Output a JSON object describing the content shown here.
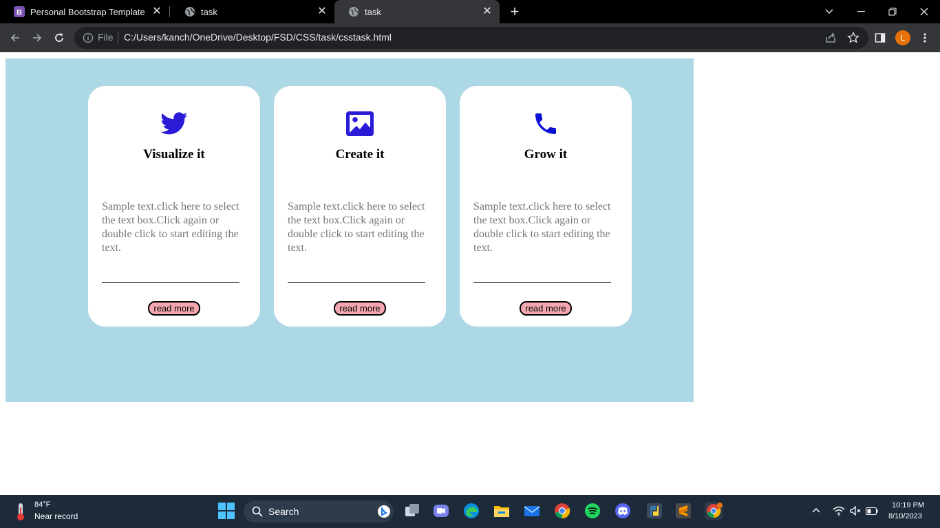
{
  "browser": {
    "tabs": [
      {
        "title": "Personal Bootstrap Template",
        "favicon": "bootstrap-icon"
      },
      {
        "title": "task",
        "favicon": "globe-icon"
      },
      {
        "title": "task",
        "favicon": "globe-icon",
        "active": true
      }
    ],
    "new_tab_symbol": "+",
    "address": {
      "scheme_label": "File",
      "url": "C:/Users/kanch/OneDrive/Desktop/FSD/CSS/task/csstask.html"
    },
    "profile_initial": "L"
  },
  "page": {
    "background_color": "#add8e6",
    "cards": [
      {
        "icon": "twitter-icon",
        "icon_color": "#2a1bd6",
        "title": "Visualize it",
        "text": "Sample text.click here to select the text box.Click again or double click to start editing the text.",
        "button": "read more"
      },
      {
        "icon": "image-icon",
        "icon_color": "#2a1bd6",
        "title": "Create it",
        "text": "Sample text.click here to select the text box.Click again or double click to start editing the text.",
        "button": "read more"
      },
      {
        "icon": "phone-icon",
        "icon_color": "#0a0fd4",
        "title": "Grow it",
        "text": "Sample text.click here to select the text box.Click again or double click to start editing the text.",
        "button": "read more"
      }
    ],
    "button_color": "#f4a7b0"
  },
  "taskbar": {
    "weather": {
      "temp": "84°F",
      "desc": "Near record"
    },
    "search_label": "Search",
    "clock": {
      "time": "10:19 PM",
      "date": "8/10/2023"
    }
  }
}
